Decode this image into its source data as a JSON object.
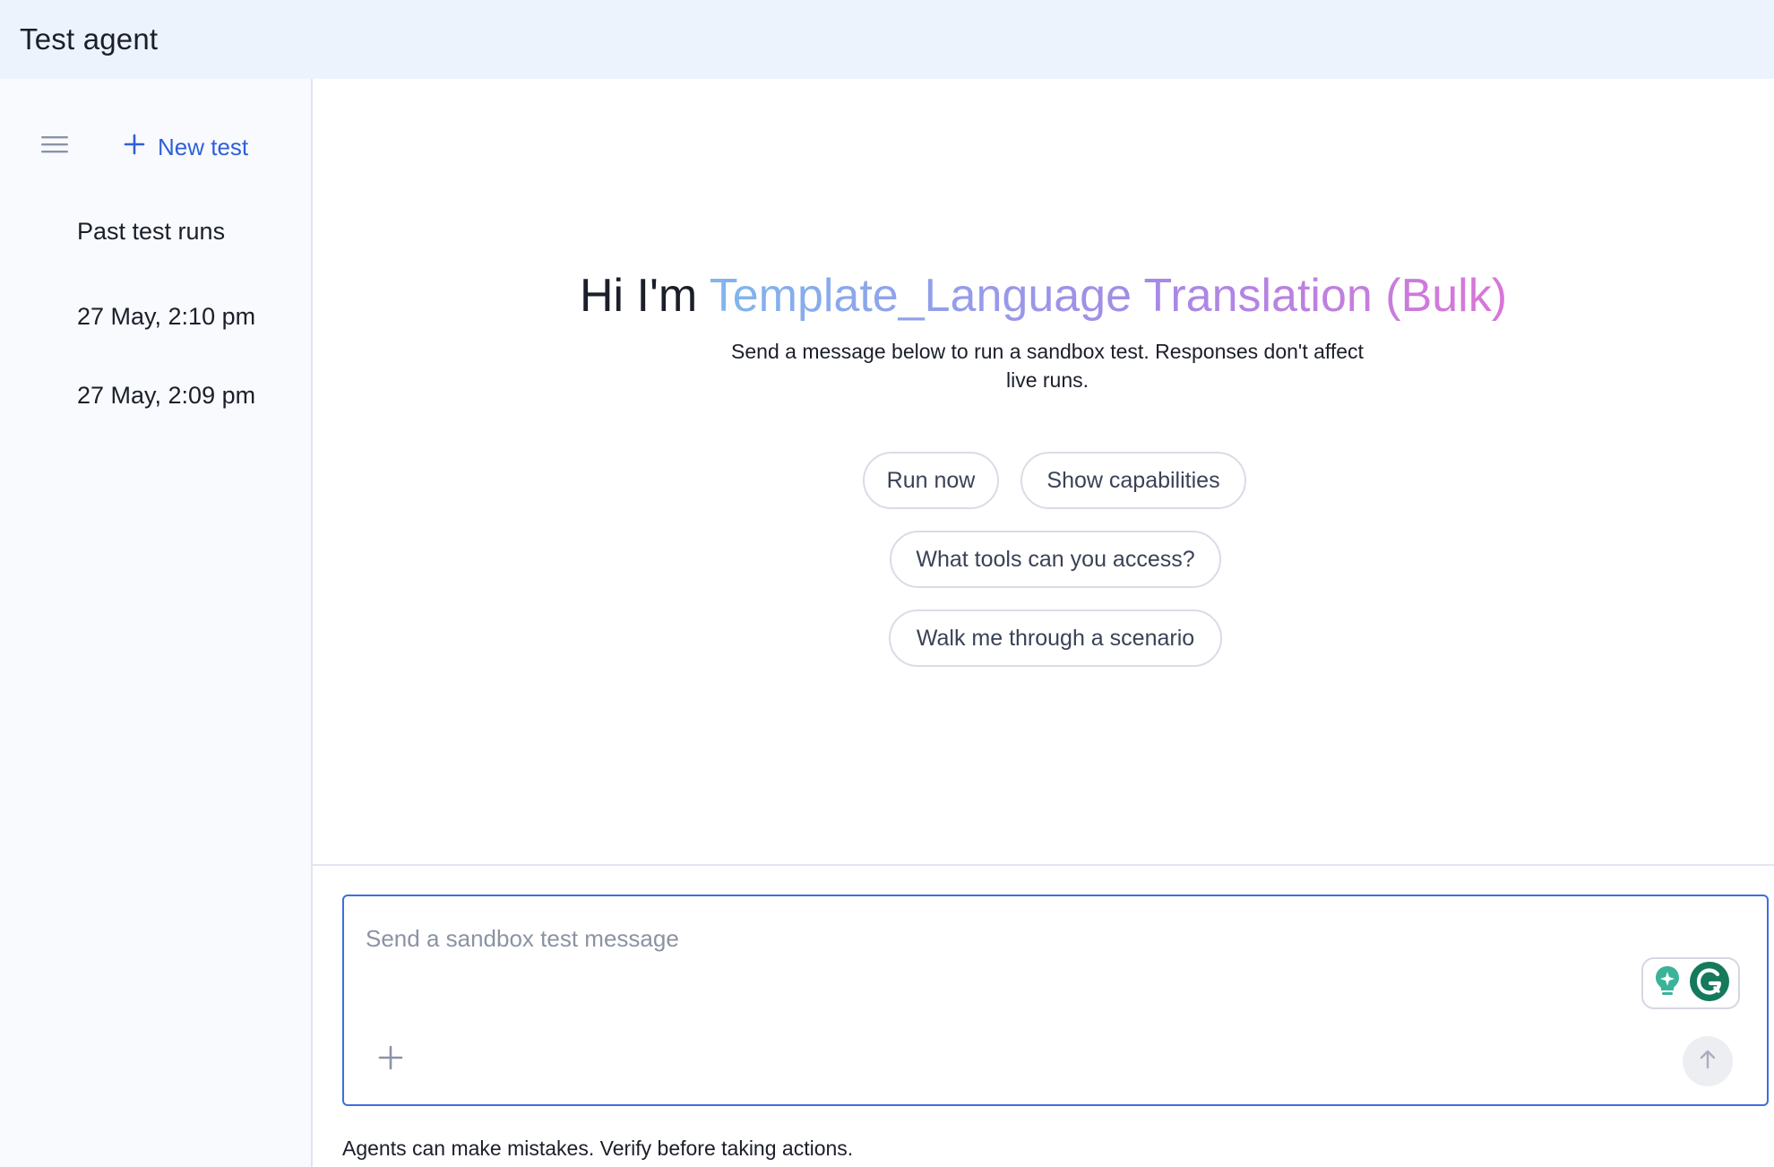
{
  "header": {
    "title": "Test agent"
  },
  "sidebar": {
    "menu_icon": "hamburger-menu-icon",
    "new_test_label": "New test",
    "past_runs_label": "Past test runs",
    "runs": [
      {
        "label": "27 May, 2:10 pm"
      },
      {
        "label": "27 May, 2:09 pm"
      }
    ]
  },
  "main": {
    "greeting_prefix": "Hi I'm ",
    "agent_name": "Template_Language Translation (Bulk)",
    "subtitle": "Send a message below to run a sandbox test. Responses don't affect live runs.",
    "suggestions": [
      {
        "label": "Run now"
      },
      {
        "label": "Show capabilities"
      },
      {
        "label": "What tools can you access?"
      },
      {
        "label": "Walk me through a scenario"
      }
    ]
  },
  "composer": {
    "placeholder": "Send a sandbox test message",
    "add_icon": "plus-icon",
    "send_icon": "arrow-up-icon",
    "extension_icons": [
      "lightbulb-icon",
      "grammarly-icon"
    ]
  },
  "footer": {
    "disclaimer": "Agents can make mistakes. Verify before taking actions."
  },
  "colors": {
    "accent": "#2f5fd8",
    "header_bg": "#edf3fd",
    "sidebar_bg": "#f8fafe",
    "composer_border": "#3d6ee0",
    "gradient_start": "#7fb6ee",
    "gradient_end": "#da75d8"
  }
}
